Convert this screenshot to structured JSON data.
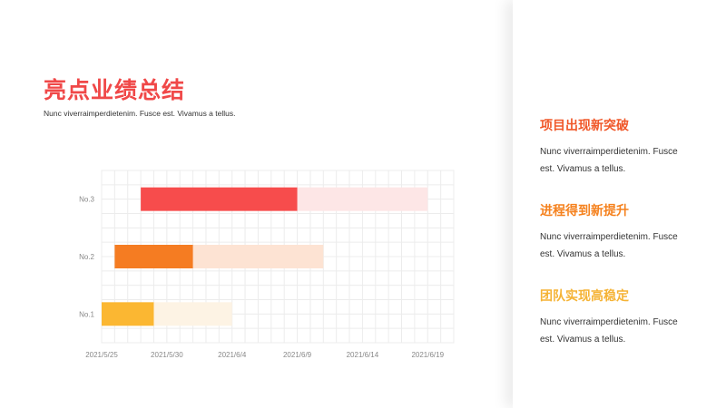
{
  "title": "亮点业绩总结",
  "subtitle": "Nunc viverraimperdietenim. Fusce est. Vivamus a tellus.",
  "highlights": [
    {
      "title": "项目出现新突破",
      "text": "Nunc viverraimperdietenim. Fusce est. Vivamus a tellus.",
      "color": "#f0582a"
    },
    {
      "title": "进程得到新提升",
      "text": "Nunc viverraimperdietenim. Fusce est. Vivamus a tellus.",
      "color": "#f5821f"
    },
    {
      "title": "团队实现高稳定",
      "text": "Nunc viverraimperdietenim. Fusce est. Vivamus a tellus.",
      "color": "#f5b335"
    }
  ],
  "chart_data": {
    "type": "bar",
    "orientation": "horizontal-gantt",
    "categories": [
      "No.3",
      "No.2",
      "No.1"
    ],
    "x_ticks": [
      "2021/5/25",
      "2021/5/30",
      "2021/6/4",
      "2021/6/9",
      "2021/6/14",
      "2021/6/19"
    ],
    "xlim": [
      "2021/5/25",
      "2021/6/21"
    ],
    "grid": true,
    "bars": [
      {
        "category": "No.3",
        "start": "2021/5/28",
        "solid_end": "2021/6/9",
        "faded_end": "2021/6/19",
        "color": "#f74c4c",
        "faded_color": "#fde6e6"
      },
      {
        "category": "No.2",
        "start": "2021/5/26",
        "solid_end": "2021/6/1",
        "faded_end": "2021/6/11",
        "color": "#f57c22",
        "faded_color": "#fde3d3"
      },
      {
        "category": "No.1",
        "start": "2021/5/25",
        "solid_end": "2021/5/29",
        "faded_end": "2021/6/4",
        "color": "#fbb732",
        "faded_color": "#fdf3e4"
      }
    ]
  }
}
